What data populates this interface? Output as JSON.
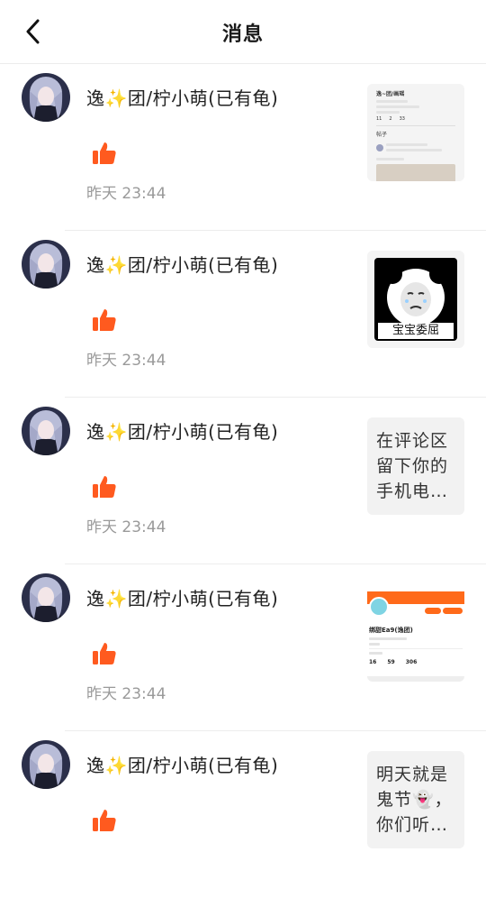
{
  "header": {
    "title": "消息"
  },
  "messages": [
    {
      "name": "逸✨团/柠小萌(已有龟)",
      "time": "昨天 23:44",
      "preview_type": "screenshot",
      "preview": {
        "title": "逸~团/画瑶",
        "stats": [
          "11",
          "2",
          "33"
        ],
        "tab": "帖子"
      }
    },
    {
      "name": "逸✨团/柠小萌(已有龟)",
      "time": "昨天 23:44",
      "preview_type": "meme",
      "preview": {
        "caption": "宝宝委屈"
      }
    },
    {
      "name": "逸✨团/柠小萌(已有龟)",
      "time": "昨天 23:44",
      "preview_type": "text",
      "preview": {
        "text": "在评论区留下你的手机电…"
      }
    },
    {
      "name": "逸✨团/柠小萌(已有龟)",
      "time": "昨天 23:44",
      "preview_type": "profile",
      "preview": {
        "title": "绑甜Ea9(逸团)",
        "stats": [
          "16",
          "59",
          "306"
        ]
      }
    },
    {
      "name": "逸✨团/柠小萌(已有龟)",
      "time": "",
      "preview_type": "text",
      "preview": {
        "text": "明天就是鬼节👻，你们听…"
      }
    }
  ],
  "colors": {
    "like": "#ff5a1f",
    "time": "#9a9a9a",
    "divider": "#ededed"
  },
  "icons": {
    "back": "chevron-left-icon",
    "like": "thumbs-up-icon"
  }
}
